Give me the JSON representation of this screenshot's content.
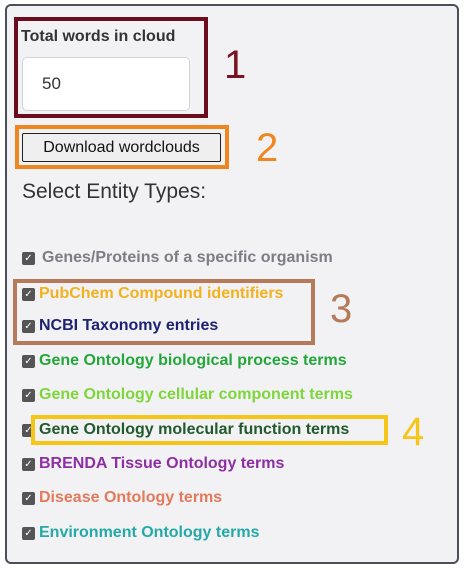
{
  "total_words": {
    "label": "Total words in cloud",
    "value": "50"
  },
  "download_button": {
    "label": "Download wordclouds"
  },
  "entity_section": {
    "title": "Select Entity Types:"
  },
  "entities": [
    {
      "label": "Genes/Proteins of a specific organism",
      "checked": true,
      "color": "#7d7d85"
    },
    {
      "label": "PubChem Compound identifiers",
      "checked": true,
      "color": "#f2b21f"
    },
    {
      "label": "NCBI Taxonomy entries",
      "checked": true,
      "color": "#1d2370"
    },
    {
      "label": "Gene Ontology biological process terms",
      "checked": true,
      "color": "#23a73a"
    },
    {
      "label": "Gene Ontology cellular component terms",
      "checked": true,
      "color": "#7ed63a"
    },
    {
      "label": "Gene Ontology molecular function terms",
      "checked": true,
      "color": "#215a2c"
    },
    {
      "label": "BRENDA Tissue Ontology terms",
      "checked": true,
      "color": "#8d2fa3"
    },
    {
      "label": "Disease Ontology terms",
      "checked": true,
      "color": "#e47a5c"
    },
    {
      "label": "Environment Ontology terms",
      "checked": true,
      "color": "#25a9a8"
    }
  ],
  "annotations": {
    "n1": "1",
    "n2": "2",
    "n3": "3",
    "n4": "4",
    "color_1": "#7a1422",
    "color_2": "#f0861f",
    "color_3": "#b47a5a",
    "color_4": "#f5c518"
  }
}
